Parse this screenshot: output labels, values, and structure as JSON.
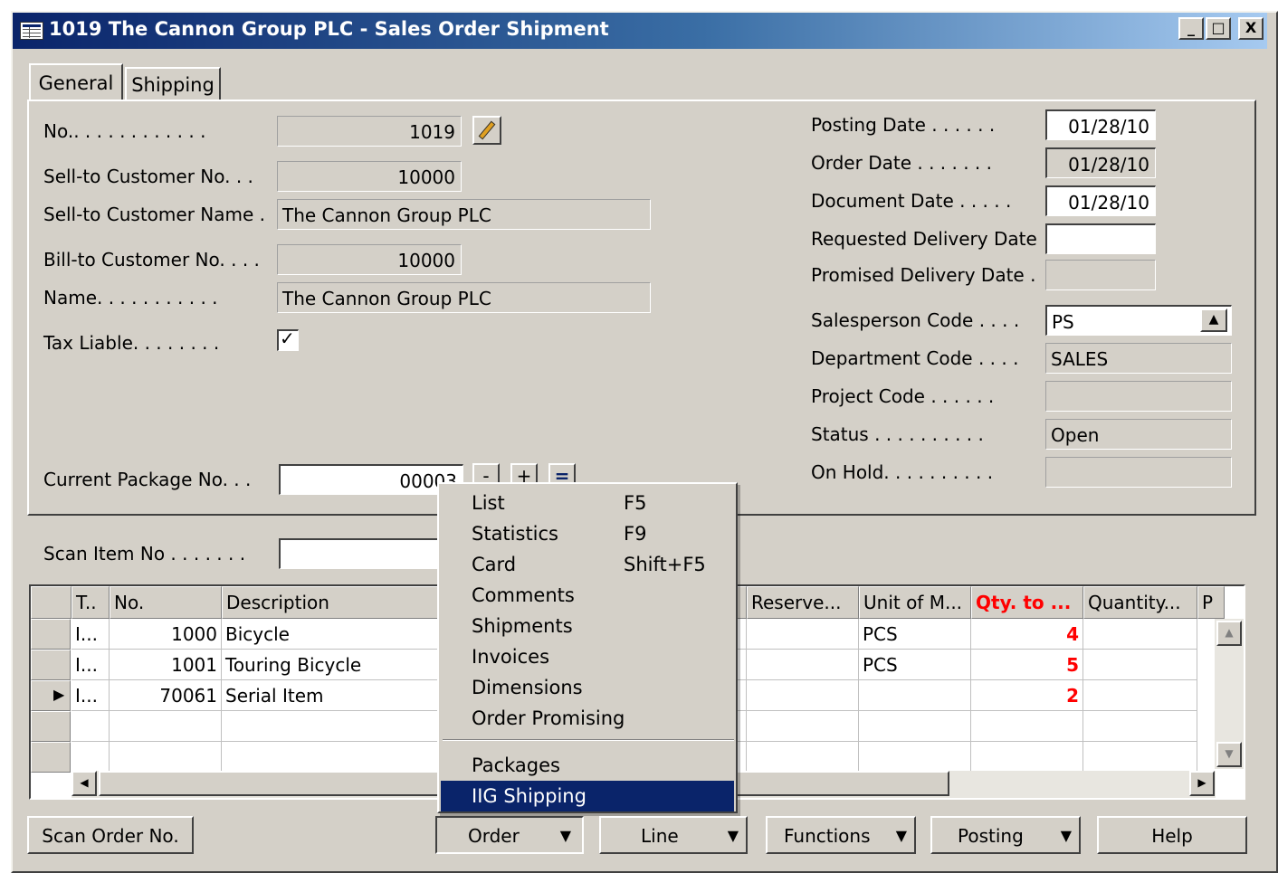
{
  "window": {
    "title": "1019 The Cannon Group PLC - Sales Order Shipment",
    "controls": {
      "minimize": "_",
      "maximize": "□",
      "close": "X"
    }
  },
  "tabs": [
    {
      "label": "General",
      "active": true
    },
    {
      "label": "Shipping",
      "active": false
    }
  ],
  "general": {
    "left_fields": {
      "no": {
        "label": "No.. . . . . . . . . . . .",
        "value": "1019"
      },
      "sell_to_no": {
        "label": "Sell-to Customer No. . .",
        "value": "10000"
      },
      "sell_to_name": {
        "label": "Sell-to Customer Name .",
        "value": "The Cannon Group PLC"
      },
      "bill_to_no": {
        "label": "Bill-to Customer No. . . .",
        "value": "10000"
      },
      "name": {
        "label": "Name. . . . . . . . . . .",
        "value": "The Cannon Group PLC"
      },
      "tax_liable": {
        "label": "Tax Liable. . . . . . . .",
        "checked": true
      },
      "current_package": {
        "label": "Current Package No. . .",
        "value": "00003",
        "buttons": [
          "-",
          "+",
          "="
        ]
      },
      "scan_item": {
        "label": "Scan Item No . . . . . . .",
        "value": ""
      }
    },
    "right_fields": {
      "posting_date": {
        "label": "Posting Date . . . . . .",
        "value": "01/28/10"
      },
      "order_date": {
        "label": "Order Date . . . . . . .",
        "value": "01/28/10"
      },
      "document_date": {
        "label": "Document Date . . . . .",
        "value": "01/28/10"
      },
      "requested_delivery": {
        "label": "Requested Delivery Date",
        "value": ""
      },
      "promised_delivery": {
        "label": "Promised Delivery Date .",
        "value": ""
      },
      "salesperson": {
        "label": "Salesperson Code . . . .",
        "value": "PS"
      },
      "department": {
        "label": "Department Code . . . .",
        "value": "SALES"
      },
      "project": {
        "label": "Project Code . . . . . .",
        "value": ""
      },
      "status": {
        "label": "Status . . . . . . . . . .",
        "value": "Open"
      },
      "on_hold": {
        "label": "On Hold. . . . . . . . . .",
        "value": ""
      }
    }
  },
  "grid": {
    "columns": [
      "T..",
      "No.",
      "Description",
      "Reserve...",
      "Unit of M...",
      "Qty. to ...",
      "Quantity...",
      "P"
    ],
    "rows": [
      {
        "type": "I...",
        "no": "1000",
        "description": "Bicycle",
        "unit": "PCS",
        "qty_to": "4"
      },
      {
        "type": "I...",
        "no": "1001",
        "description": "Touring Bicycle",
        "unit": "PCS",
        "qty_to": "5"
      },
      {
        "type": "I...",
        "no": "70061",
        "description": "Serial Item",
        "unit": "",
        "qty_to": "2"
      }
    ]
  },
  "menu": {
    "items": [
      {
        "label": "List",
        "shortcut": "F5"
      },
      {
        "label": "Statistics",
        "shortcut": "F9"
      },
      {
        "label": "Card",
        "shortcut": "Shift+F5"
      },
      {
        "label": "Comments",
        "shortcut": ""
      },
      {
        "label": "Shipments",
        "shortcut": ""
      },
      {
        "label": "Invoices",
        "shortcut": ""
      },
      {
        "label": "Dimensions",
        "shortcut": ""
      },
      {
        "label": "Order Promising",
        "shortcut": ""
      }
    ],
    "items_after_separator": [
      {
        "label": "Packages",
        "shortcut": "",
        "highlighted": false
      },
      {
        "label": "IIG Shipping",
        "shortcut": "",
        "highlighted": true
      }
    ]
  },
  "buttons": {
    "scan_order": "Scan Order No.",
    "order": "Order",
    "line": "Line",
    "functions": "Functions",
    "posting": "Posting",
    "help": "Help"
  },
  "colors": {
    "titlebar_start": "#0a246a",
    "titlebar_end": "#a6caf0",
    "highlight": "#0a246a",
    "qty_red": "#ff0000",
    "face": "#d4d0c8"
  }
}
